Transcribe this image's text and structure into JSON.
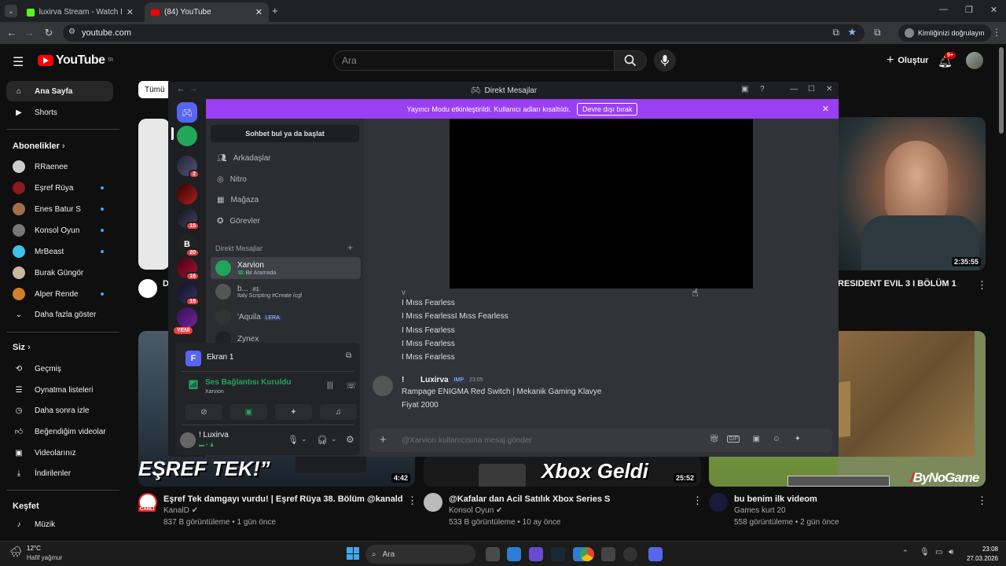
{
  "browser": {
    "tabs": [
      {
        "title": "luxirva Stream - Watch Live on K"
      },
      {
        "title": "(84) YouTube"
      }
    ],
    "url": "youtube.com",
    "profile_label": "Kimliğinizi doğrulayın"
  },
  "youtube": {
    "logo": "YouTube",
    "logo_sup": "TR",
    "search_placeholder": "Ara",
    "create_label": "Oluştur",
    "notif_count": "9+",
    "chip": "Tümü",
    "sidebar": {
      "home": "Ana Sayfa",
      "shorts": "Shorts",
      "subs_header": "Abonelikler",
      "subs": [
        "RRaenee",
        "Eşref Rüya",
        "Enes Batur S",
        "Konsol Oyun",
        "MrBeast",
        "Burak Güngör",
        "Alper Rende"
      ],
      "show_more": "Daha fazla göster",
      "you_header": "Siz",
      "you_items": [
        "Geçmiş",
        "Oynatma listeleri",
        "Daha sonra izle",
        "Beğendiğim videolar",
        "Videolarınız",
        "İndirilenler"
      ],
      "explore_header": "Keşfet",
      "music": "Müzik"
    },
    "videos_top": [
      {
        "title": "RESIDENT EVIL 3 I BÖLÜM 1",
        "duration": "2:35:55"
      }
    ],
    "videos_bottom": [
      {
        "title": "Eşref Tek damgayı vurdu! | Eşref Rüya 38. Bölüm @kanald",
        "channel": "KanalD",
        "meta": "837 B görüntüleme • 1 gün önce",
        "duration": "4:42",
        "thumb_text": "EŞREF TEK!”",
        "live_badge": "CANLI"
      },
      {
        "title": "@Kafalar  dan Acil Satılık Xbox Series S",
        "channel": "Konsol Oyun",
        "meta": "533 B görüntüleme • 10 ay önce",
        "duration": "25:52",
        "thumb_text": "Xbox Geldi"
      },
      {
        "title": "bu benim ilk videom",
        "channel": "Games kurt 20",
        "meta": "558 görüntüleme • 2 gün önce",
        "duration": "",
        "thumb_text": ""
      }
    ],
    "watermark": "ByNoGame"
  },
  "discord": {
    "window_title": "Direkt Mesajlar",
    "banner_text": "Yayıncı Modu etkinleştirildi. Kullanıcı adları kısaltıldı.",
    "banner_button": "Devre dışı bırak",
    "find_chat": "Sohbet bul ya da başlat",
    "nav": [
      "Arkadaşlar",
      "Nitro",
      "Mağaza",
      "Görevler"
    ],
    "dm_header": "Direkt Mesajlar",
    "dms": [
      {
        "name": "Xarvion",
        "sub": "Bir Aramada"
      },
      {
        "name": "b...",
        "tag": "#1",
        "sub": "Italy Scripting #Create /cgf"
      },
      {
        "name": "'Aquila",
        "tag": "LERA"
      },
      {
        "name": "Zynex"
      }
    ],
    "server_badges": [
      "2",
      "15",
      "15",
      "20",
      "16",
      "15"
    ],
    "new_label": "YENİ",
    "voice": {
      "screen_label": "Ekran 1",
      "status": "Ses Bağlantısı Kuruldu",
      "channel": "Xarvion",
      "user": "! Luxirva"
    },
    "messages_fearless": [
      "I Mıss Fearless",
      "I Mıss FearlessI Mıss Fearless",
      "I Mıss Fearless",
      "I Mıss Fearless",
      "I Mıss Fearless"
    ],
    "last_msg": {
      "author": "Luxirva",
      "author_prefix": "!",
      "tag": "IMP",
      "time": "23:05",
      "lines": [
        "Rampage ENIGMA Red Switch | Mekanik Gaming Klavye",
        "Fiyat 2000"
      ]
    },
    "input_placeholder": "@Xarvion kullanıcısına mesaj gönder"
  },
  "taskbar": {
    "weather_temp": "12°C",
    "weather_desc": "Hafif yağmur",
    "search_label": "Ara",
    "time": "23:08",
    "date": "27.03.2026"
  },
  "colors": {
    "yt_red": "#ff0000",
    "discord_purple": "#9b3ff2",
    "discord_green": "#23a55a",
    "link_blue": "#3ea6ff"
  }
}
